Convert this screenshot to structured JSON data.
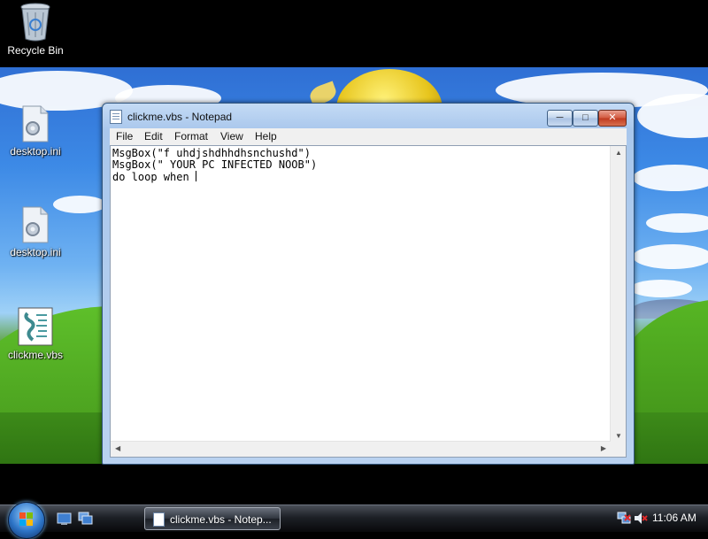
{
  "desktop": {
    "icons": [
      {
        "label": "Recycle Bin",
        "icon": "recycle-bin-icon"
      },
      {
        "label": "desktop.ini",
        "icon": "settings-file-icon"
      },
      {
        "label": "desktop.ini",
        "icon": "settings-file-icon"
      },
      {
        "label": "clickme.vbs",
        "icon": "script-file-icon"
      }
    ]
  },
  "notepad": {
    "title": "clickme.vbs - Notepad",
    "menu": [
      "File",
      "Edit",
      "Format",
      "View",
      "Help"
    ],
    "lines": [
      "MsgBox(\"f uhdjshdhhdhsnchushd\")",
      "MsgBox(\" YOUR PC INFECTED NOOB\")",
      "do loop when "
    ],
    "controls": {
      "minimize": "minimize-icon",
      "maximize": "maximize-icon",
      "close": "close-icon"
    }
  },
  "taskbar": {
    "task_button": "clickme.vbs - Notep...",
    "clock": "11:06 AM",
    "colors": {
      "accent": "#2d74c7",
      "taskbar": "#1d2026"
    }
  }
}
